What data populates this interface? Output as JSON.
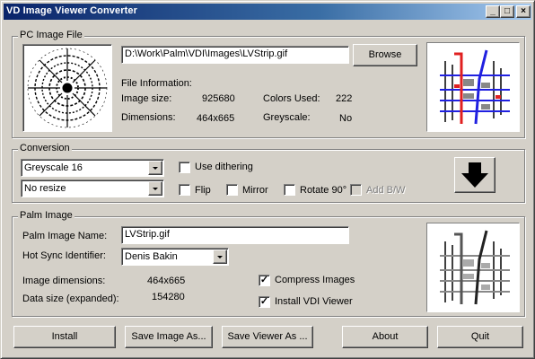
{
  "window": {
    "title": "VD Image Viewer Converter"
  },
  "title_buttons": {
    "minimize": "_",
    "maximize": "□",
    "close": "×"
  },
  "pc_image": {
    "group_label": "PC Image File",
    "path": "D:\\Work\\Palm\\VDI\\Images\\LVStrip.gif",
    "browse_label": "Browse",
    "info_label": "File Information:",
    "image_size_label": "Image size:",
    "image_size_value": "925680",
    "colors_used_label": "Colors Used:",
    "colors_used_value": "222",
    "dimensions_label": "Dimensions:",
    "dimensions_value": "464x665",
    "greyscale_label": "Greyscale:",
    "greyscale_value": "No"
  },
  "conversion": {
    "group_label": "Conversion",
    "depth_select": "Greyscale 16",
    "resize_select": "No resize",
    "use_dithering_label": "Use dithering",
    "use_dithering": false,
    "flip_label": "Flip",
    "flip": false,
    "mirror_label": "Mirror",
    "mirror": false,
    "rotate_label": "Rotate 90°",
    "rotate": false,
    "add_bw_label": "Add B/W",
    "add_bw": false
  },
  "palm_image": {
    "group_label": "Palm Image",
    "name_label": "Palm Image Name:",
    "name_value": "LVStrip.gif",
    "hotsync_label": "Hot Sync Identifier:",
    "hotsync_value": "Denis Bakin",
    "image_dimensions_label": "Image dimensions:",
    "image_dimensions_value": "464x665",
    "data_size_label": "Data size (expanded):",
    "data_size_value": "154280",
    "compress_label": "Compress Images",
    "compress": true,
    "install_viewer_label": "Install VDI Viewer",
    "install_viewer": true
  },
  "buttons": {
    "install": "Install",
    "save_image_as": "Save Image As...",
    "save_viewer_as": "Save Viewer As ...",
    "about": "About",
    "quit": "Quit"
  },
  "icons": {
    "convert": "down-arrow-icon",
    "source_preview": "spiral-pattern-icon",
    "map_preview": "street-map-icon"
  },
  "colors": {
    "title_gradient_start": "#0a246a",
    "title_gradient_end": "#a6caf0",
    "face": "#d4d0c8"
  }
}
